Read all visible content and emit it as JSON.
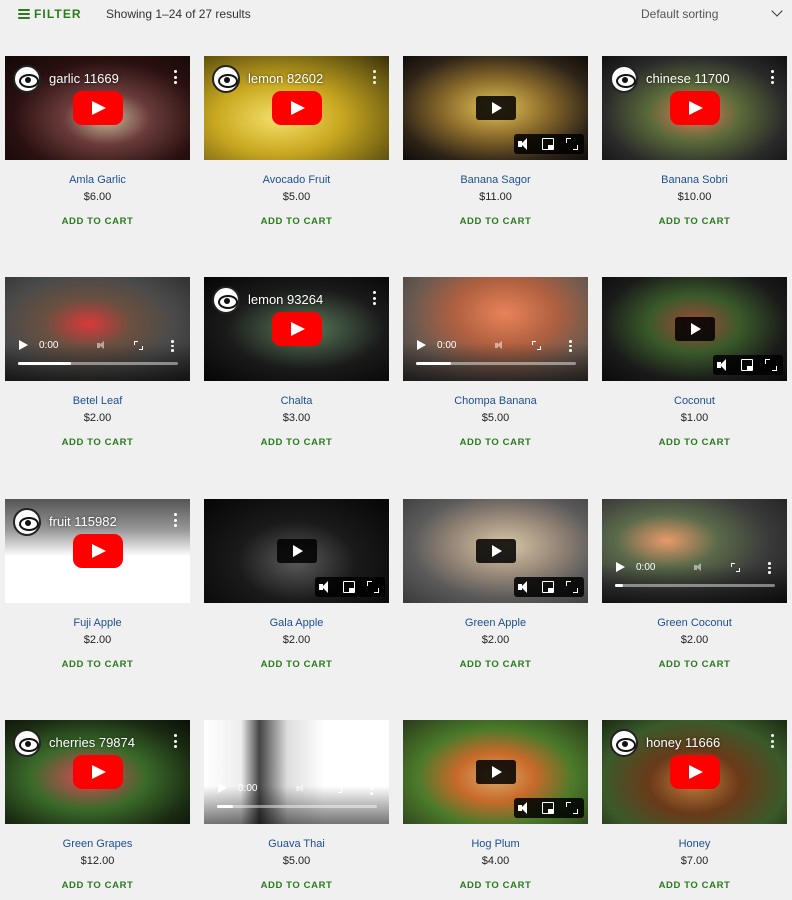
{
  "toolbar": {
    "filter_label": "FILTER",
    "result_count": "Showing 1–24 of 27 results",
    "sort_selected": "Default sorting"
  },
  "products": [
    {
      "title": "Amla Garlic",
      "price": "$6.00",
      "cart": "ADD TO CART",
      "media": {
        "kind": "youtube",
        "caption": "garlic 11669",
        "icon": "channel-logo-icon"
      }
    },
    {
      "title": "Avocado Fruit",
      "price": "$5.00",
      "cart": "ADD TO CART",
      "media": {
        "kind": "youtube",
        "caption": "lemon 82602",
        "icon": "channel-logo-icon"
      }
    },
    {
      "title": "Banana Sagor",
      "price": "$11.00",
      "cart": "ADD TO CART",
      "media": {
        "kind": "player"
      }
    },
    {
      "title": "Banana Sobri",
      "price": "$10.00",
      "cart": "ADD TO CART",
      "media": {
        "kind": "youtube",
        "caption": "chinese 11700",
        "icon": "channel-logo-icon"
      }
    },
    {
      "title": "Betel Leaf",
      "price": "$2.00",
      "cart": "ADD TO CART",
      "media": {
        "kind": "native",
        "time": "0:00",
        "progress": 0.33
      }
    },
    {
      "title": "Chalta",
      "price": "$3.00",
      "cart": "ADD TO CART",
      "media": {
        "kind": "youtube",
        "caption": "lemon 93264",
        "icon": "channel-logo-icon"
      }
    },
    {
      "title": "Chompa Banana",
      "price": "$5.00",
      "cart": "ADD TO CART",
      "media": {
        "kind": "native",
        "time": "0:00",
        "progress": 0.22
      }
    },
    {
      "title": "Coconut",
      "price": "$1.00",
      "cart": "ADD TO CART",
      "media": {
        "kind": "player"
      }
    },
    {
      "title": "Fuji Apple",
      "price": "$2.00",
      "cart": "ADD TO CART",
      "media": {
        "kind": "youtube",
        "caption": "fruit 115982",
        "icon": "channel-logo-icon"
      }
    },
    {
      "title": "Gala Apple",
      "price": "$2.00",
      "cart": "ADD TO CART",
      "media": {
        "kind": "player"
      }
    },
    {
      "title": "Green Apple",
      "price": "$2.00",
      "cart": "ADD TO CART",
      "media": {
        "kind": "player"
      }
    },
    {
      "title": "Green Coconut",
      "price": "$2.00",
      "cart": "ADD TO CART",
      "media": {
        "kind": "native",
        "time": "0:00",
        "progress": 0.05
      }
    },
    {
      "title": "Green Grapes",
      "price": "$12.00",
      "cart": "ADD TO CART",
      "media": {
        "kind": "youtube",
        "caption": "cherries 79874",
        "icon": "channel-logo-icon"
      }
    },
    {
      "title": "Guava Thai",
      "price": "$5.00",
      "cart": "ADD TO CART",
      "media": {
        "kind": "native",
        "time": "0:00",
        "progress": 0.1
      }
    },
    {
      "title": "Hog Plum",
      "price": "$4.00",
      "cart": "ADD TO CART",
      "media": {
        "kind": "player"
      }
    },
    {
      "title": "Honey",
      "price": "$7.00",
      "cart": "ADD TO CART",
      "media": {
        "kind": "youtube",
        "caption": "honey 11666",
        "icon": "channel-logo-icon"
      }
    }
  ],
  "colors": {
    "accent": "#2a7a1e",
    "link": "#1d4f91",
    "yt_red": "#ff0000"
  }
}
